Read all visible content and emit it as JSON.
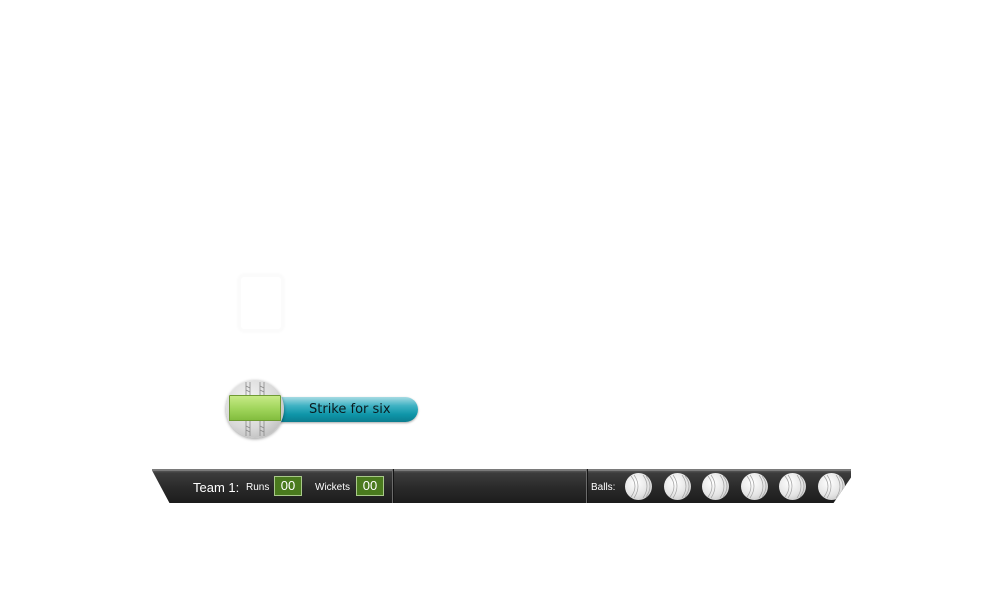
{
  "game": {
    "strike_button_label": "Strike for six"
  },
  "scoreboard": {
    "team_label": "Team 1:",
    "runs_label": "Runs",
    "runs_value": "00",
    "wickets_label": "Wickets",
    "wickets_value": "00",
    "balls_label": "Balls:",
    "balls_remaining": 6
  },
  "colors": {
    "strike_bar": "#0e95a8",
    "counter_bg": "#4a7a1e",
    "scorebar_bg": "#2a2a2a",
    "pitch_green": "#9fd45a"
  },
  "icons": {
    "ball": "cricket-ball-icon",
    "pitch": "cricket-pitch-icon"
  }
}
